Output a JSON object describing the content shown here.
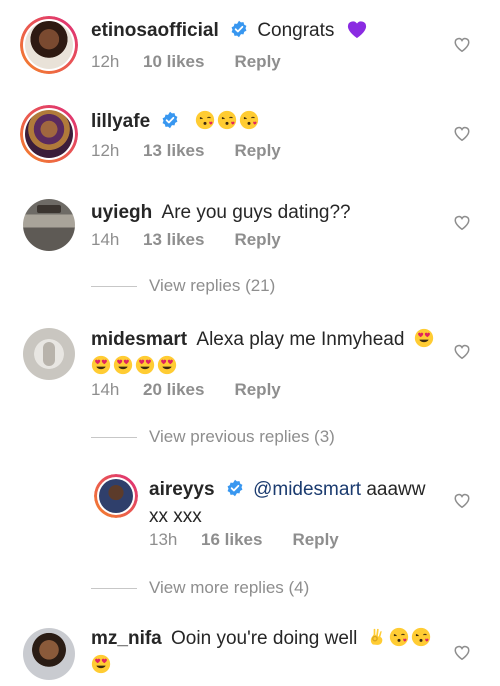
{
  "comments": [
    {
      "username": "etinosaofficial",
      "verified": true,
      "text": "Congrats",
      "time": "12h",
      "likes": "10 likes",
      "reply": "Reply"
    },
    {
      "username": "lillyafe",
      "verified": true,
      "text": "",
      "time": "12h",
      "likes": "13 likes",
      "reply": "Reply"
    },
    {
      "username": "uyiegh",
      "verified": false,
      "text": "Are you guys dating??",
      "time": "14h",
      "likes": "13 likes",
      "reply": "Reply"
    },
    {
      "username": "midesmart",
      "verified": false,
      "text": "Alexa play me Inmyhead",
      "time": "14h",
      "likes": "20 likes",
      "reply": "Reply"
    },
    {
      "username": "aireyys",
      "verified": true,
      "mention": "@midesmart",
      "text": "aaaww",
      "text_line2": "xx xxx",
      "time": "13h",
      "likes": "16 likes",
      "reply": "Reply"
    },
    {
      "username": "mz_nifa",
      "verified": false,
      "text": "Ooin you're doing well",
      "time": "",
      "likes": "",
      "reply": ""
    }
  ],
  "view_replies_1": "View replies (21)",
  "view_previous_replies": "View previous replies (3)",
  "view_more_replies": "View more replies (4)",
  "colors": {
    "username": "#262626",
    "meta": "#8e8e8e",
    "verified": "#3897f0",
    "story_ring_start": "#f58529",
    "story_ring_end": "#dd2a7b",
    "purple_heart": "#8a2be2"
  },
  "icons": [
    "verified-badge-icon",
    "heart-outline-icon",
    "purple-heart-emoji",
    "kissing-heart-emoji",
    "heart-eyes-emoji",
    "ok-hand-emoji"
  ]
}
